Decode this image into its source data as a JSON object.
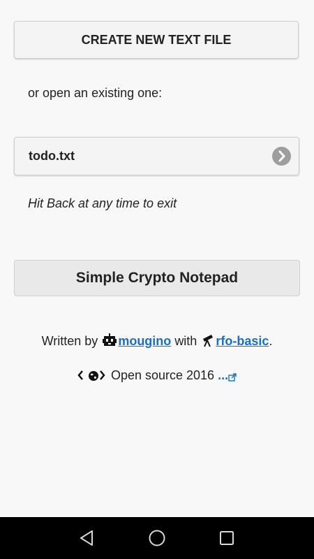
{
  "create_button": {
    "label": "CREATE NEW TEXT FILE"
  },
  "open_existing": {
    "label": "or open an existing one:"
  },
  "files": [
    {
      "name": "todo.txt"
    }
  ],
  "hint": {
    "text": "Hit Back at any time to exit"
  },
  "app_title_button": {
    "label": "Simple Crypto Notepad"
  },
  "credits": {
    "written_by": "Written by",
    "author_link": "mougino",
    "with": "with",
    "tool_link": "rfo-basic",
    "period": "."
  },
  "opensource": {
    "text": "Open source 2016",
    "more_link": "..."
  },
  "icons": {
    "author": "robot-head-icon",
    "tool": "telescope-icon",
    "code": "code-brackets-icon",
    "globe": "globe-icon",
    "external": "external-link-icon",
    "chevron": "chevron-right-icon"
  },
  "colors": {
    "background": "#f8f8f8",
    "link": "#1f6fb8",
    "navbar": "#000000"
  }
}
